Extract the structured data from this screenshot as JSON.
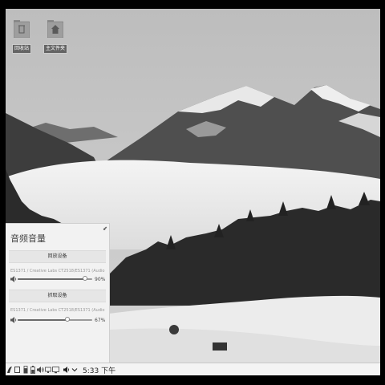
{
  "desktop": {
    "icons": [
      {
        "label": "回收站",
        "icon": "trash-folder-icon"
      },
      {
        "label": "主文件夹",
        "icon": "home-folder-icon"
      }
    ]
  },
  "volume_panel": {
    "title": "音频音量",
    "pin_glyph": "⬋",
    "playback": {
      "header": "回放设备",
      "device": "ES1371 / Creative Labs CT2518/ES1371 (AudioPCI) A",
      "percent_label": "90%",
      "level": 0.9
    },
    "capture": {
      "header": "抓取设备",
      "device": "ES1371 / Creative Labs CT2518/ES1371 (AudioPCI) A",
      "percent_label": "67%",
      "level": 0.67
    }
  },
  "taskbar": {
    "tray_icons": [
      "app-logo-icon",
      "window-icon",
      "usb-icon",
      "battery-icon",
      "volume-icon",
      "network-icon",
      "display-icon",
      "speaker-icon",
      "chevron-down-icon"
    ],
    "clock": "5:33 下午"
  }
}
